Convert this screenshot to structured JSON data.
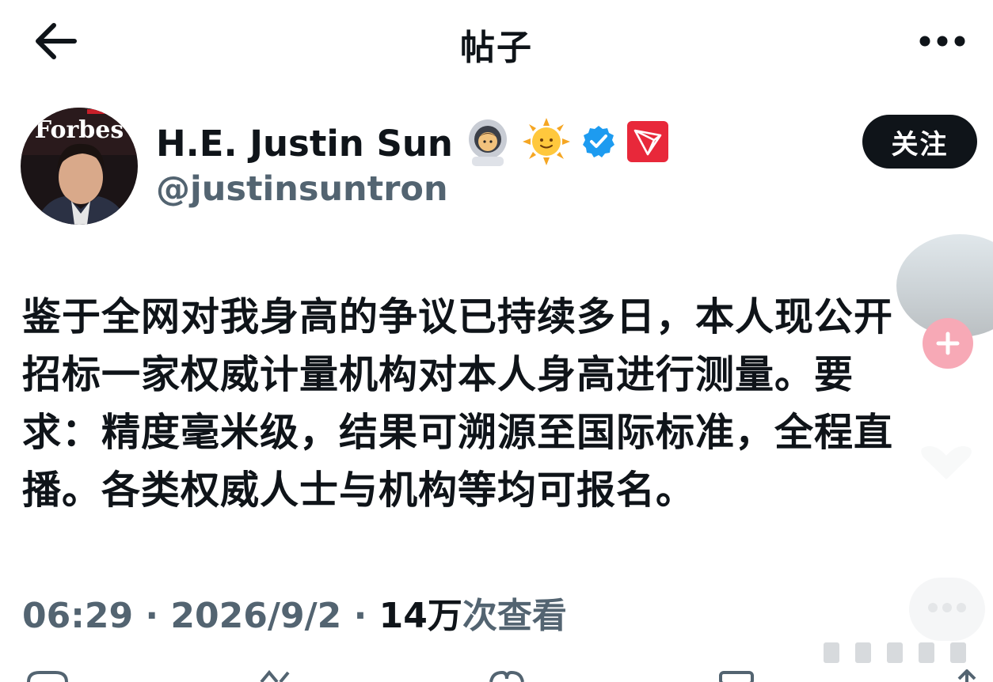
{
  "header": {
    "title": "帖子",
    "back_icon": "arrow-left-icon",
    "more_icon": "more-horizontal-icon"
  },
  "author": {
    "display_name": "H.E. Justin Sun",
    "handle": "@justinsuntron",
    "avatar_text": "Forbes",
    "badges": [
      "astronaut-emoji",
      "sun-emoji",
      "verified-badge-icon",
      "tron-logo-icon"
    ],
    "follow_label": "关注"
  },
  "post": {
    "lines": [
      "鉴于全网对我身高的争议已持续多日，本人现公开",
      "招标一家权威计量机构对本人身高进行测量。要",
      "求：精度毫米级，结果可溯源至国际标准，全程直",
      "播。各类权威人士与机构等均可报名。"
    ]
  },
  "meta": {
    "time": "06:29",
    "date": "2026/9/2",
    "views_count": "14万",
    "views_label": "次查看"
  },
  "colors": {
    "text": "#0f1419",
    "secondary": "#536471",
    "follow_bg": "#0f1419",
    "verified": "#1d9bf0",
    "tron": "#e8283a",
    "plus_bg": "#f7a9b6"
  }
}
